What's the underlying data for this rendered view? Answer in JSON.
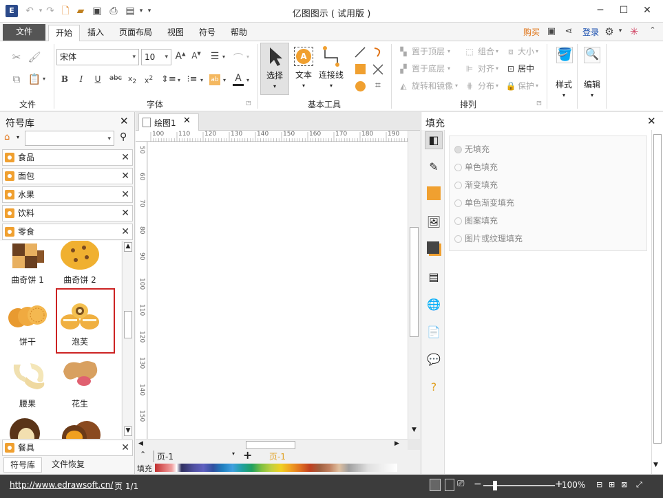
{
  "window": {
    "title": "亿图图示 ( 试用版 )"
  },
  "menu": {
    "tabs": [
      "文件",
      "开始",
      "插入",
      "页面布局",
      "视图",
      "符号",
      "帮助"
    ],
    "buy": "购买",
    "login": "登录"
  },
  "ribbon": {
    "clipboard_label": "文件",
    "font": {
      "name": "宋体",
      "size": "10",
      "label": "字体"
    },
    "basic_tools": {
      "select": "选择",
      "text": "文本",
      "connector": "连接线",
      "label": "基本工具"
    },
    "arrange": {
      "bring_front": "置于顶层",
      "send_back": "置于底层",
      "rotate_mirror": "旋转和镜像",
      "group": "组合",
      "align": "对齐",
      "distribute": "分布",
      "size": "大小",
      "center": "居中",
      "protect": "保护",
      "label": "排列"
    },
    "style": "样式",
    "edit": "编辑"
  },
  "library": {
    "title": "符号库",
    "categories": [
      "食品",
      "面包",
      "水果",
      "饮料",
      "零食"
    ],
    "symbols": [
      "曲奇饼 1",
      "曲奇饼 2",
      "饼干",
      "泡芙",
      "腰果",
      "花生"
    ],
    "bottom_category": "餐具",
    "tabs": [
      "符号库",
      "文件恢复"
    ]
  },
  "document": {
    "tab": "绘图1",
    "ruler_h": [
      "100",
      "110",
      "120",
      "130",
      "140",
      "150",
      "160",
      "170",
      "180",
      "190"
    ],
    "ruler_v": [
      "50",
      "60",
      "70",
      "80",
      "90",
      "100",
      "110",
      "120",
      "130",
      "140",
      "150"
    ],
    "page_tab": "页-1",
    "page_tab_active": "页-1",
    "fill_label": "填充"
  },
  "fill_panel": {
    "title": "填充",
    "options": [
      "无填充",
      "单色填充",
      "渐变填充",
      "单色渐变填充",
      "图案填充",
      "图片或纹理填充"
    ]
  },
  "status": {
    "url": "http://www.edrawsoft.cn/",
    "page": "页 1/1",
    "zoom": "100%"
  },
  "colors": {
    "accent": "#f0a030",
    "highlight_box": "#cc2222"
  }
}
